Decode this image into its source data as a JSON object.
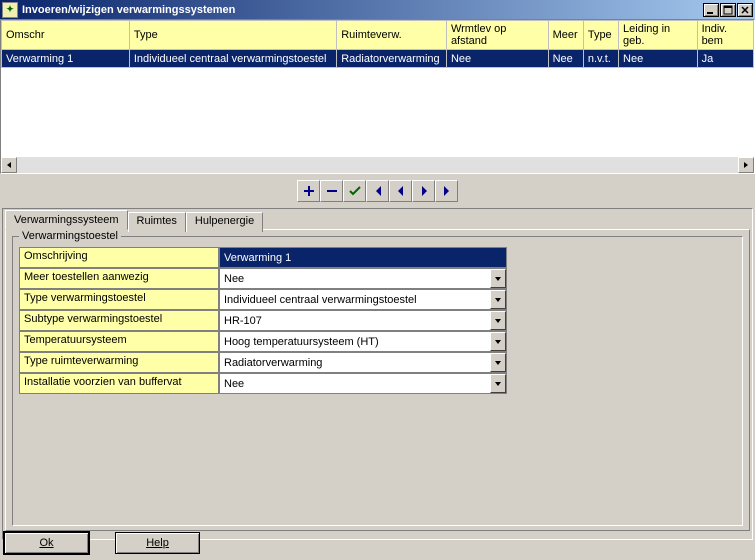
{
  "window": {
    "title": "Invoeren/wijzigen verwarmingssystemen"
  },
  "grid": {
    "headers": [
      "Omschr",
      "Type",
      "Ruimteverw.",
      "Wrmtlev op afstand",
      "Meer",
      "Type",
      "Leiding in geb.",
      "Indiv. bem"
    ],
    "rows": [
      [
        "Verwarming 1",
        "Individueel centraal verwarmingstoestel",
        "Radiatorverwarming",
        "Nee",
        "Nee",
        "n.v.t.",
        "Nee",
        "Ja"
      ]
    ]
  },
  "toolbar": {
    "items": [
      "plus",
      "minus",
      "check",
      "first",
      "prev",
      "next",
      "last"
    ]
  },
  "tabs": {
    "items": [
      "Verwarmingssysteem",
      "Ruimtes",
      "Hulpenergie"
    ],
    "active": 0
  },
  "group": {
    "title": "Verwarmingstoestel",
    "fields": [
      {
        "label": "Omschrijving",
        "value": "Verwarming 1",
        "type": "text-sel"
      },
      {
        "label": "Meer toestellen aanwezig",
        "value": "Nee",
        "type": "dropdown"
      },
      {
        "label": "Type verwarmingstoestel",
        "value": "Individueel centraal verwarmingstoestel",
        "type": "dropdown"
      },
      {
        "label": "Subtype verwarmingstoestel",
        "value": "HR-107",
        "type": "dropdown"
      },
      {
        "label": "Temperatuursysteem",
        "value": "Hoog temperatuursysteem (HT)",
        "type": "dropdown"
      },
      {
        "label": "Type ruimteverwarming",
        "value": "Radiatorverwarming",
        "type": "dropdown"
      },
      {
        "label": "Installatie voorzien van buffervat",
        "value": "Nee",
        "type": "dropdown"
      }
    ]
  },
  "footer": {
    "ok": "Ok",
    "help": "Help"
  }
}
